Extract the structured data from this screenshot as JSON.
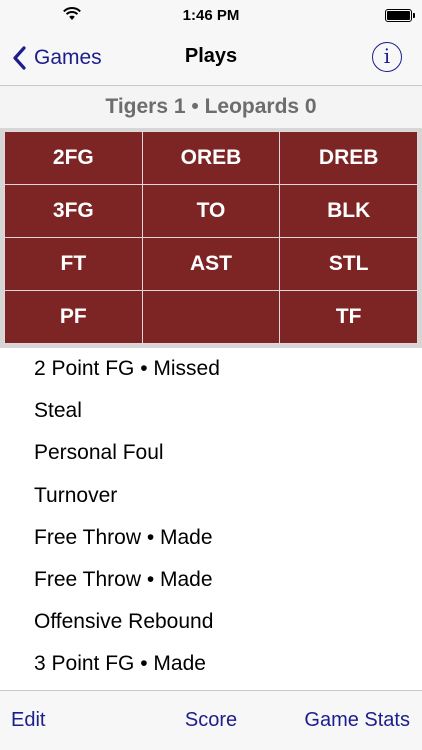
{
  "status_bar": {
    "time": "1:46 PM"
  },
  "nav": {
    "back_label": "Games",
    "title": "Plays",
    "info_label": "i"
  },
  "score_header": "Tigers 1 • Leopards 0",
  "play_buttons": [
    "2FG",
    "OREB",
    "DREB",
    "3FG",
    "TO",
    "BLK",
    "FT",
    "AST",
    "STL",
    "PF",
    "",
    "TF"
  ],
  "plays": [
    "2 Point FG • Missed",
    "Steal",
    "Personal Foul",
    "Turnover",
    "Free Throw • Made",
    "Free Throw • Made",
    "Offensive Rebound",
    "3 Point FG • Made"
  ],
  "toolbar": {
    "edit_label": "Edit",
    "score_label": "Score",
    "stats_label": "Game Stats"
  },
  "colors": {
    "accent": "#1c1e8c",
    "button_bg": "#7d2525",
    "score_text": "#6d6d6d"
  }
}
